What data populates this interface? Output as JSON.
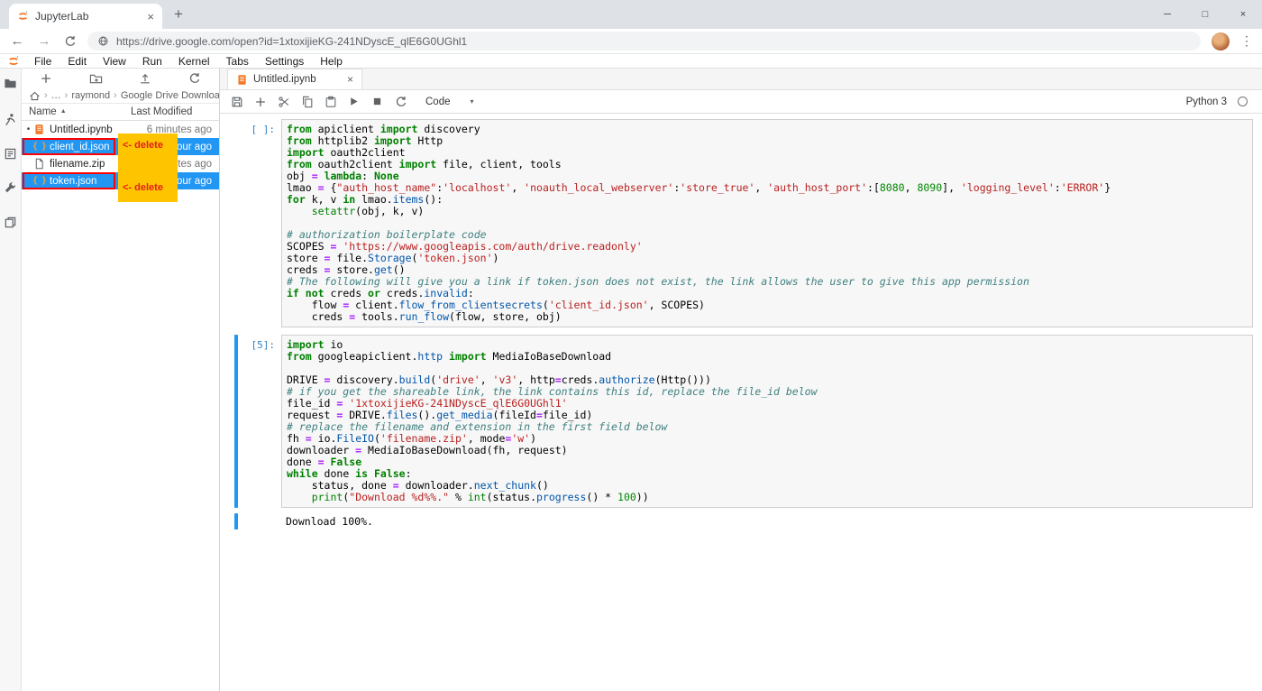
{
  "colors": {
    "selection_blue": "#2196f3",
    "jupyter_orange": "#f37726",
    "annotation_yellow": "#ffc400",
    "annotation_red": "#e02020",
    "outline_red": "#ff0000"
  },
  "browser": {
    "tab_title": "JupyterLab",
    "url": "https://drive.google.com/open?id=1xtoxijieKG-241NDyscE_qlE6G0UGhl1",
    "window_controls": {
      "minimize": "─",
      "maximize": "□",
      "close": "×"
    }
  },
  "menubar": {
    "items": [
      "File",
      "Edit",
      "View",
      "Run",
      "Kernel",
      "Tabs",
      "Settings",
      "Help"
    ]
  },
  "sidebar": {
    "icons": [
      "file-browser",
      "running-sessions",
      "command-palette",
      "property-inspector",
      "open-tabs"
    ]
  },
  "filebrowser": {
    "toolbar_icons": [
      "new-launcher",
      "new-folder",
      "upload",
      "refresh"
    ],
    "breadcrumb": {
      "ellipsis": "…",
      "separator": "›",
      "items": [
        "raymond",
        "Google Drive Download"
      ]
    },
    "columns": {
      "name": "Name",
      "sort_caret": "▲",
      "modified": "Last Modified"
    },
    "files": [
      {
        "type": "notebook",
        "name": "Untitled.ipynb",
        "modified": "6 minutes ago",
        "running": true,
        "selected": false,
        "red_box": false
      },
      {
        "type": "json",
        "name": "client_id.json",
        "modified": "hour ago",
        "running": false,
        "selected": true,
        "red_box": true
      },
      {
        "type": "file",
        "name": "filename.zip",
        "modified": "utes ago",
        "running": false,
        "selected": false,
        "red_box": false
      },
      {
        "type": "json",
        "name": "token.json",
        "modified": "hour ago",
        "running": false,
        "selected": true,
        "red_box": true
      }
    ]
  },
  "annotations": {
    "delete_top": "<- delete",
    "delete_bottom": "<- delete"
  },
  "notebook": {
    "tab_title": "Untitled.ipynb",
    "toolbar_icons": [
      "save",
      "add-cell",
      "cut",
      "copy",
      "paste",
      "run",
      "stop",
      "restart"
    ],
    "toolbar": {
      "cell_type": "Code",
      "dropdown_caret": "▾",
      "kernel_name": "Python 3"
    },
    "cells": [
      {
        "prompt": "[ ]:",
        "active": false,
        "lines": [
          [
            [
              "k",
              "from"
            ],
            [
              "t",
              " apiclient "
            ],
            [
              "k",
              "import"
            ],
            [
              "t",
              " discovery"
            ]
          ],
          [
            [
              "k",
              "from"
            ],
            [
              "t",
              " httplib2 "
            ],
            [
              "k",
              "import"
            ],
            [
              "t",
              " Http"
            ]
          ],
          [
            [
              "k",
              "import"
            ],
            [
              "t",
              " oauth2client"
            ]
          ],
          [
            [
              "k",
              "from"
            ],
            [
              "t",
              " oauth2client "
            ],
            [
              "k",
              "import"
            ],
            [
              "t",
              " file, client, tools"
            ]
          ],
          [
            [
              "t",
              "obj "
            ],
            [
              "o",
              "="
            ],
            [
              "t",
              " "
            ],
            [
              "k",
              "lambda"
            ],
            [
              "t",
              ": "
            ],
            [
              "k",
              "None"
            ]
          ],
          [
            [
              "t",
              "lmao "
            ],
            [
              "o",
              "="
            ],
            [
              "t",
              " {"
            ],
            [
              "s",
              "\"auth_host_name\""
            ],
            [
              "t",
              ":"
            ],
            [
              "s",
              "'localhost'"
            ],
            [
              "t",
              ", "
            ],
            [
              "s",
              "'noauth_local_webserver'"
            ],
            [
              "t",
              ":"
            ],
            [
              "s",
              "'store_true'"
            ],
            [
              "t",
              ", "
            ],
            [
              "s",
              "'auth_host_port'"
            ],
            [
              "t",
              ":["
            ],
            [
              "n",
              "8080"
            ],
            [
              "t",
              ", "
            ],
            [
              "n",
              "8090"
            ],
            [
              "t",
              "], "
            ],
            [
              "s",
              "'logging_level'"
            ],
            [
              "t",
              ":"
            ],
            [
              "s",
              "'ERROR'"
            ],
            [
              "t",
              "}"
            ]
          ],
          [
            [
              "k",
              "for"
            ],
            [
              "t",
              " k, v "
            ],
            [
              "k",
              "in"
            ],
            [
              "t",
              " lmao."
            ],
            [
              "p",
              "items"
            ],
            [
              "t",
              "():"
            ]
          ],
          [
            [
              "t",
              "    "
            ],
            [
              "b",
              "setattr"
            ],
            [
              "t",
              "(obj, k, v)"
            ]
          ],
          [],
          [
            [
              "c",
              "# authorization boilerplate code"
            ]
          ],
          [
            [
              "t",
              "SCOPES "
            ],
            [
              "o",
              "="
            ],
            [
              "t",
              " "
            ],
            [
              "s",
              "'https://www.googleapis.com/auth/drive.readonly'"
            ]
          ],
          [
            [
              "t",
              "store "
            ],
            [
              "o",
              "="
            ],
            [
              "t",
              " file."
            ],
            [
              "p",
              "Storage"
            ],
            [
              "t",
              "("
            ],
            [
              "s",
              "'token.json'"
            ],
            [
              "t",
              ")"
            ]
          ],
          [
            [
              "t",
              "creds "
            ],
            [
              "o",
              "="
            ],
            [
              "t",
              " store."
            ],
            [
              "p",
              "get"
            ],
            [
              "t",
              "()"
            ]
          ],
          [
            [
              "c",
              "# The following will give you a link if token.json does not exist, the link allows the user to give this app permission"
            ]
          ],
          [
            [
              "k",
              "if"
            ],
            [
              "t",
              " "
            ],
            [
              "k",
              "not"
            ],
            [
              "t",
              " creds "
            ],
            [
              "k",
              "or"
            ],
            [
              "t",
              " creds."
            ],
            [
              "p",
              "invalid"
            ],
            [
              "t",
              ":"
            ]
          ],
          [
            [
              "t",
              "    flow "
            ],
            [
              "o",
              "="
            ],
            [
              "t",
              " client."
            ],
            [
              "p",
              "flow_from_clientsecrets"
            ],
            [
              "t",
              "("
            ],
            [
              "s",
              "'client_id.json'"
            ],
            [
              "t",
              ", SCOPES)"
            ]
          ],
          [
            [
              "t",
              "    creds "
            ],
            [
              "o",
              "="
            ],
            [
              "t",
              " tools."
            ],
            [
              "p",
              "run_flow"
            ],
            [
              "t",
              "(flow, store, obj)"
            ]
          ]
        ]
      },
      {
        "prompt": "[5]:",
        "active": true,
        "output": "Download 100%.",
        "lines": [
          [
            [
              "k",
              "import"
            ],
            [
              "t",
              " io"
            ]
          ],
          [
            [
              "k",
              "from"
            ],
            [
              "t",
              " googleapiclient."
            ],
            [
              "p",
              "http"
            ],
            [
              "t",
              " "
            ],
            [
              "k",
              "import"
            ],
            [
              "t",
              " MediaIoBaseDownload"
            ]
          ],
          [],
          [
            [
              "t",
              "DRIVE "
            ],
            [
              "o",
              "="
            ],
            [
              "t",
              " discovery."
            ],
            [
              "p",
              "build"
            ],
            [
              "t",
              "("
            ],
            [
              "s",
              "'drive'"
            ],
            [
              "t",
              ", "
            ],
            [
              "s",
              "'v3'"
            ],
            [
              "t",
              ", http"
            ],
            [
              "o",
              "="
            ],
            [
              "t",
              "creds."
            ],
            [
              "p",
              "authorize"
            ],
            [
              "t",
              "(Http()))"
            ]
          ],
          [
            [
              "c",
              "# if you get the shareable link, the link contains this id, replace the file_id below"
            ]
          ],
          [
            [
              "t",
              "file_id "
            ],
            [
              "o",
              "="
            ],
            [
              "t",
              " "
            ],
            [
              "s",
              "'1xtoxijieKG-241NDyscE_qlE6G0UGhl1'"
            ]
          ],
          [
            [
              "t",
              "request "
            ],
            [
              "o",
              "="
            ],
            [
              "t",
              " DRIVE."
            ],
            [
              "p",
              "files"
            ],
            [
              "t",
              "()."
            ],
            [
              "p",
              "get_media"
            ],
            [
              "t",
              "(fileId"
            ],
            [
              "o",
              "="
            ],
            [
              "t",
              "file_id)"
            ]
          ],
          [
            [
              "c",
              "# replace the filename and extension in the first field below"
            ]
          ],
          [
            [
              "t",
              "fh "
            ],
            [
              "o",
              "="
            ],
            [
              "t",
              " io."
            ],
            [
              "p",
              "FileIO"
            ],
            [
              "t",
              "("
            ],
            [
              "s",
              "'filename.zip'"
            ],
            [
              "t",
              ", mode"
            ],
            [
              "o",
              "="
            ],
            [
              "s",
              "'w'"
            ],
            [
              "t",
              ")"
            ]
          ],
          [
            [
              "t",
              "downloader "
            ],
            [
              "o",
              "="
            ],
            [
              "t",
              " MediaIoBaseDownload(fh, request)"
            ]
          ],
          [
            [
              "t",
              "done "
            ],
            [
              "o",
              "="
            ],
            [
              "t",
              " "
            ],
            [
              "k",
              "False"
            ]
          ],
          [
            [
              "k",
              "while"
            ],
            [
              "t",
              " done "
            ],
            [
              "k",
              "is"
            ],
            [
              "t",
              " "
            ],
            [
              "k",
              "False"
            ],
            [
              "t",
              ":"
            ]
          ],
          [
            [
              "t",
              "    status, done "
            ],
            [
              "o",
              "="
            ],
            [
              "t",
              " downloader."
            ],
            [
              "p",
              "next_chunk"
            ],
            [
              "t",
              "()"
            ]
          ],
          [
            [
              "t",
              "    "
            ],
            [
              "b",
              "print"
            ],
            [
              "t",
              "("
            ],
            [
              "s",
              "\"Download %d%%.\""
            ],
            [
              "t",
              " % "
            ],
            [
              "b",
              "int"
            ],
            [
              "t",
              "(status."
            ],
            [
              "p",
              "progress"
            ],
            [
              "t",
              "() * "
            ],
            [
              "n",
              "100"
            ],
            [
              "t",
              "))"
            ]
          ]
        ]
      }
    ]
  }
}
